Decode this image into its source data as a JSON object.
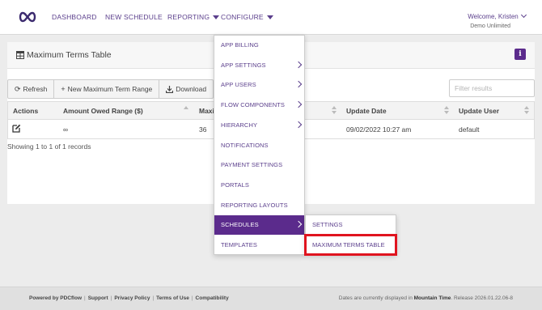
{
  "colors": {
    "brand": "#5b2b8c",
    "nav_text": "#5b3f8c",
    "highlight": "#e0141f"
  },
  "nav": {
    "logo_icon": "infinity-icon",
    "items": [
      {
        "label": "DASHBOARD"
      },
      {
        "label": "NEW SCHEDULE"
      },
      {
        "label": "REPORTING"
      },
      {
        "label": "CONFIGURE"
      }
    ],
    "welcome": "Welcome, Kristen",
    "org": "Demo Unlimited"
  },
  "panel": {
    "title_icon": "table-icon",
    "title": "Maximum Terms Table",
    "info_label": "i"
  },
  "toolbar": {
    "refresh": "Refresh",
    "new_range": "New Maximum Term Range",
    "download": "Download",
    "filter_placeholder": "Filter results"
  },
  "table": {
    "columns": [
      "Actions",
      "Amount Owed Range ($)",
      "Maxi",
      "Update Date",
      "Update User"
    ],
    "rows": [
      {
        "amount": "∞",
        "maxi": "36",
        "update_date": "09/02/2022 10:27 am",
        "update_user": "default"
      }
    ],
    "records_text": "Showing 1 to 1 of 1 records"
  },
  "configure_menu": {
    "items": [
      {
        "label": "APP BILLING"
      },
      {
        "label": "APP SETTINGS"
      },
      {
        "label": "APP USERS"
      },
      {
        "label": "FLOW COMPONENTS"
      },
      {
        "label": "HIERARCHY"
      },
      {
        "label": "NOTIFICATIONS"
      },
      {
        "label": "PAYMENT SETTINGS"
      },
      {
        "label": "PORTALS"
      },
      {
        "label": "REPORTING LAYOUTS"
      },
      {
        "label": "SCHEDULES"
      },
      {
        "label": "TEMPLATES"
      }
    ],
    "active": "SCHEDULES"
  },
  "schedules_submenu": {
    "items": [
      {
        "label": "SETTINGS"
      },
      {
        "label": "MAXIMUM TERMS TABLE"
      }
    ],
    "highlighted": "MAXIMUM TERMS TABLE"
  },
  "footer": {
    "powered": "Powered by PDCflow",
    "links": [
      "Support",
      "Privacy Policy",
      "Terms of Use",
      "Compatibility"
    ],
    "time_prefix": "Dates are currently displayed in",
    "timezone": "Mountain Time",
    "release": ". Release 2026.01.22.06-8"
  }
}
